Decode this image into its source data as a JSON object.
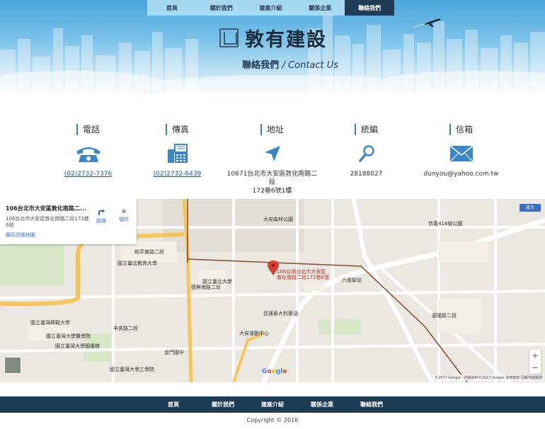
{
  "header": {
    "nav": [
      "首頁",
      "關於我們",
      "建案介紹",
      "關係企業",
      "聯絡我們"
    ],
    "active_index": 4,
    "brand_name": "敦有建設",
    "subtitle_zh": "聯絡我們",
    "subtitle_en": "/ Contact Us"
  },
  "contact": {
    "phone": {
      "title": "電話",
      "value": "(02)2732-7376"
    },
    "fax": {
      "title": "傳真",
      "value": "(02)2732-6439"
    },
    "address": {
      "title": "地址",
      "line1": "10671台北市大安區敦化南路二段",
      "line2": "172巷6號1樓"
    },
    "tax_id": {
      "title": "統編",
      "value": "28188027"
    },
    "email": {
      "title": "信箱",
      "value": "dunyou@yahoo.com.tw"
    }
  },
  "map": {
    "card_title": "106台北市大安區敦化南路二...",
    "card_address": "106台北市大安區敦化南路二段172巷6號",
    "card_link": "顯示詳細地圖",
    "directions_label": "路線",
    "save_label": "儲存",
    "marker_line1": "106台灣台北市大安區",
    "marker_line2": "敦化南路二段172巷6號",
    "enlarge_label": "放大",
    "zoom_in": "+",
    "zoom_out": "−",
    "google": "Google",
    "attribution": "©2017 Google - 地圖資料©2017 Google   使用條款   回報地圖錯誤",
    "labels": [
      {
        "name": "map-label-daan-park",
        "text": "大安森林公園"
      },
      {
        "name": "map-label-ntnu",
        "text": "國立臺灣師範大學"
      },
      {
        "name": "map-label-xinyi",
        "text": "信義414號公園"
      },
      {
        "name": "map-label-zhongzheng",
        "text": "國立臺北教育大學"
      },
      {
        "name": "map-label-heping",
        "text": "和平東路二段"
      },
      {
        "name": "map-label-xinhai",
        "text": "辛亥路二段"
      },
      {
        "name": "map-label-ntu",
        "text": "國立臺灣大學醫學院"
      },
      {
        "name": "map-label-liuzhangli",
        "text": "六張犁站"
      },
      {
        "name": "map-label-fuxing",
        "text": "復興南路二段"
      },
      {
        "name": "map-label-keelung",
        "text": "基隆路二段"
      },
      {
        "name": "map-label-da-an-sports",
        "text": "大安運動中心"
      },
      {
        "name": "map-label-ntust",
        "text": "國立臺灣大學工學院"
      },
      {
        "name": "map-label-ntu-lib",
        "text": "國立臺灣大學圖書館"
      },
      {
        "name": "map-label-yiwu",
        "text": "亞運泰大利萊涵"
      },
      {
        "name": "map-label-jinmen",
        "text": "金門國中"
      },
      {
        "name": "map-label-shida-yuanqu",
        "text": "國立臺北大學"
      }
    ]
  },
  "footer": {
    "nav": [
      "首頁",
      "關於我們",
      "建案介紹",
      "關係企業",
      "聯絡我們"
    ],
    "copyright": "Copyright © 2016"
  },
  "colors": {
    "nav_dark": "#1e3c58",
    "accent_blue": "#3c7fc0",
    "icon_blue": "#3a86c8",
    "link": "#2156a8"
  }
}
